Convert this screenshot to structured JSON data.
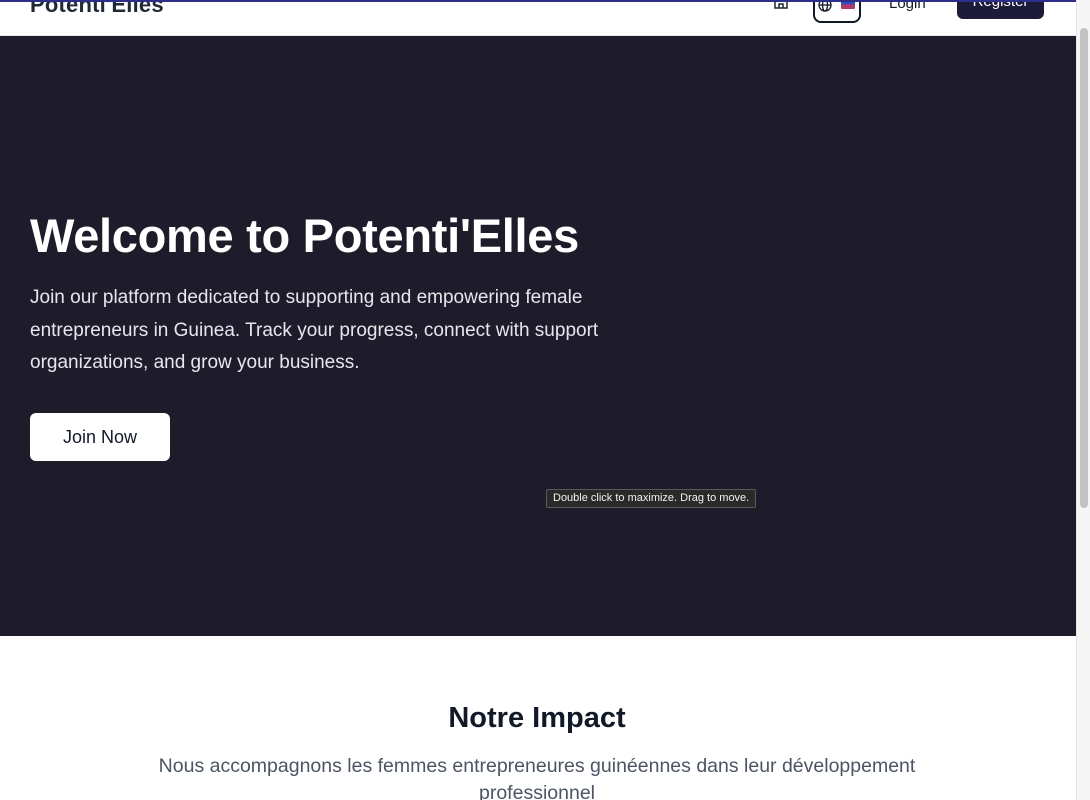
{
  "header": {
    "brand": "Potenti'Elles",
    "login_label": "Login",
    "register_label": "Register",
    "icons": {
      "home": "home-icon",
      "language": "globe-icon",
      "flag": "flag-icon"
    }
  },
  "hero": {
    "title": "Welcome to Potenti'Elles",
    "description": "Join our platform dedicated to supporting and empowering female entrepreneurs in Guinea. Track your progress, connect with support organizations, and grow your business.",
    "cta_label": "Join Now",
    "background_color": "#1e1c2b"
  },
  "tooltip": {
    "text": "Double click to maximize. Drag to move."
  },
  "impact": {
    "title": "Notre Impact",
    "description": "Nous accompagnons les femmes entrepreneures guinéennes dans leur développement professionnel"
  },
  "colors": {
    "accent": "#1e1b3a",
    "top_line": "#2b2f8a"
  }
}
